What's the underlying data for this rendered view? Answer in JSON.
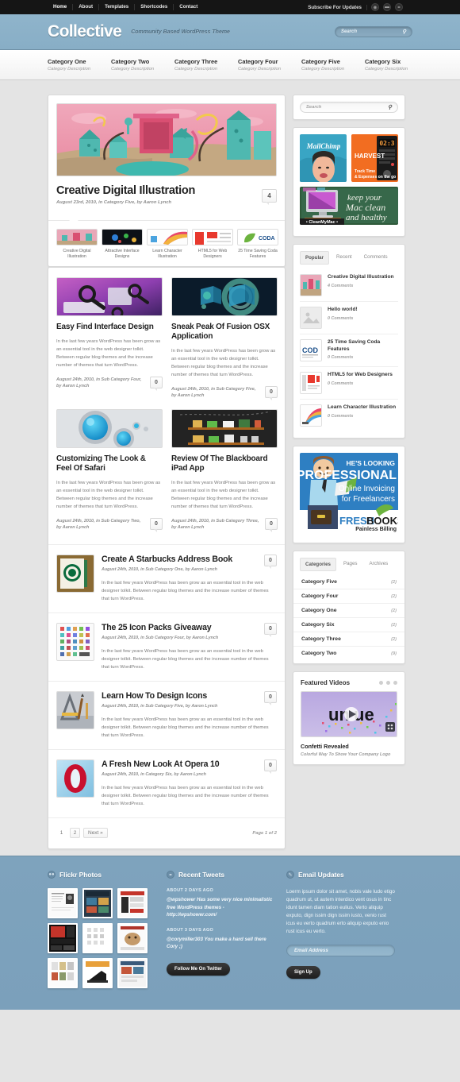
{
  "topbar": {
    "nav": [
      "Home",
      "About",
      "Templates",
      "Shortcodes",
      "Contact"
    ],
    "subscribe_label": "Subscribe For Updates",
    "social": [
      "rss-icon",
      "email-icon",
      "twitter-icon"
    ]
  },
  "header": {
    "logo": "Collective",
    "tagline": "Community Based WordPress Theme",
    "search_placeholder": "Search"
  },
  "catnav": [
    {
      "title": "Category One",
      "desc": "Category Description"
    },
    {
      "title": "Category Two",
      "desc": "Category Description"
    },
    {
      "title": "Category Three",
      "desc": "Category Description"
    },
    {
      "title": "Category Four",
      "desc": "Category Description"
    },
    {
      "title": "Category Five",
      "desc": "Category Description"
    },
    {
      "title": "Category Six",
      "desc": "Category Description"
    }
  ],
  "featured": {
    "title": "Creative Digital Illustration",
    "meta": "August 23rd, 2010, in Category Five, by Aaron Lynch",
    "comments": "4",
    "thumbs": [
      {
        "label": "Creative Digital Illustration"
      },
      {
        "label": "Attractive Interface Designs"
      },
      {
        "label": "Learn Character Illustration"
      },
      {
        "label": "HTML5 for Web Designers"
      },
      {
        "label": "25 Time Saving Coda Features"
      }
    ]
  },
  "grid_posts": [
    {
      "title": "Easy Find Interface Design",
      "excerpt": "In the last few years WordPress has been grow as an essential tool in the web designer tolkit. Between regular blog themes and the increase number of themes that turn WordPress.",
      "meta": "August 24th, 2010, in Sub Category Four, by Aaron Lynch",
      "comments": "0"
    },
    {
      "title": "Sneak Peak Of Fusion OSX Application",
      "excerpt": "In the last few years WordPress has been grow as an essential tool in the web designer tolkit. Between regular blog themes and the increase number of themes that turn WordPress.",
      "meta": "August 24th, 2010, in Sub Category Five, by Aaron Lynch",
      "comments": "0"
    },
    {
      "title": "Customizing The Look & Feel Of Safari",
      "excerpt": "In the last few years WordPress has been grow as an essential tool in the web designer tolkit. Between regular blog themes and the increase number of themes that turn WordPress.",
      "meta": "August 24th, 2010, in Sub Category Two, by Aaron Lynch",
      "comments": "0"
    },
    {
      "title": "Review Of The Blackboard iPad App",
      "excerpt": "In the last few years WordPress has been grow as an essential tool in the web designer tolkit. Between regular blog themes and the increase number of themes that turn WordPress.",
      "meta": "August 24th, 2010, in Sub Category Three, by Aaron Lynch",
      "comments": "0"
    }
  ],
  "list_posts": [
    {
      "title": "Create A Starbucks Address Book",
      "meta": "August 24th, 2010, in Sub Category One, by Aaron Lynch",
      "excerpt": "In the last few years WordPress has been grow as an essential tool in the web designer tolkit. Between regular blog themes and the increase number of themes that turn WordPress.",
      "comments": "0"
    },
    {
      "title": "The 25 Icon Packs Giveaway",
      "meta": "August 24th, 2010, in Sub Category Four, by Aaron Lynch",
      "excerpt": "In the last few years WordPress has been grow as an essential tool in the web designer tolkit. Between regular blog themes and the increase number of themes that turn WordPress.",
      "comments": "0"
    },
    {
      "title": "Learn How To Design Icons",
      "meta": "August 24th, 2010, in Sub Category Five, by Aaron Lynch",
      "excerpt": "In the last few years WordPress has been grow as an essential tool in the web designer tolkit. Between regular blog themes and the increase number of themes that turn WordPress.",
      "comments": "0"
    },
    {
      "title": "A Fresh New Look At Opera 10",
      "meta": "August 24th, 2010, in Category Six, by Aaron Lynch",
      "excerpt": "In the last few years WordPress has been grow as an essential tool in the web designer tolkit. Between regular blog themes and the increase number of themes that turn WordPress.",
      "comments": "0"
    }
  ],
  "pagination": {
    "pages": [
      "1",
      "2"
    ],
    "next_label": "Next »",
    "page_note": "Page 1 of 2"
  },
  "sidebar": {
    "search_placeholder": "Search",
    "ads": [
      {
        "name": "MailChimp",
        "text": "MailChimp"
      },
      {
        "name": "Harvest",
        "text": "HARVEST",
        "sub": "Track Time & Expenses on the go",
        "timer": "02:3"
      },
      {
        "name": "CleanMyMac",
        "text": "keep your Mac clean and healthy",
        "badge": "• CleanMyMac •"
      },
      {
        "name": "FreshBooks",
        "line1": "HE'S LOOKING",
        "line2": "PROFESSIONAL",
        "line3": "Online Invoicing",
        "line4": "for Freelancers",
        "brand1": "FRESH",
        "brand2": "BOOKS",
        "brand3": "Painless Billing"
      }
    ],
    "popular_tabs": [
      "Popular",
      "Recent",
      "Comments"
    ],
    "popular_active": "Popular",
    "popular_items": [
      {
        "title": "Creative Digital Illustration",
        "comments": "4 Comments"
      },
      {
        "title": "Hello world!",
        "comments": "0 Comments"
      },
      {
        "title": "25 Time Saving Coda Features",
        "comments": "0 Comments"
      },
      {
        "title": "HTML5 for Web Designers",
        "comments": "0 Comments"
      },
      {
        "title": "Learn Character Illustration",
        "comments": "0 Comments"
      }
    ],
    "cat_tabs": [
      "Categories",
      "Pages",
      "Archives"
    ],
    "cat_active": "Categories",
    "categories": [
      {
        "name": "Category Five",
        "count": "(2)"
      },
      {
        "name": "Category Four",
        "count": "(2)"
      },
      {
        "name": "Category One",
        "count": "(2)"
      },
      {
        "name": "Category Six",
        "count": "(2)"
      },
      {
        "name": "Category Three",
        "count": "(2)"
      },
      {
        "name": "Category Two",
        "count": "(9)"
      }
    ],
    "videos": {
      "heading": "Featured Videos",
      "video_title": "Confetti Revealed",
      "video_sub": "Colorful Way To Show Your Company Logo",
      "overlay_text": "unique"
    }
  },
  "footer": {
    "flickr": {
      "heading": "Flickr Photos",
      "icon": "flickr-icon"
    },
    "tweets": {
      "heading": "Recent Tweets",
      "icon": "twitter-icon",
      "items": [
        {
          "when": "ABOUT 2 DAYS AGO",
          "text": "@wpshower Has some very nice minimalistic free WordPress themes - http://wpshower.com/"
        },
        {
          "when": "ABOUT 3 DAYS AGO",
          "text": "@corymiller303 You make a hard sell there Cory ;)"
        }
      ],
      "button": "Follow Me On Twitter"
    },
    "email": {
      "heading": "Email Updates",
      "icon": "mail-icon",
      "text": "Loerm ipsum dolor sit amet, nobis vale ludo etigo quadrum ut, ut autem interdico vent osus in tinc idunt tamen diam tation eulius. Verto aliquip exputo, dign issim dign issim iusto, venio rust icus eu verto quadrum erto aliquip exputo enio rust icus eu verto.",
      "input_placeholder": "Email Address",
      "button": "Sign Up"
    }
  },
  "colors": {
    "topbar": "#151515",
    "header_band": "#8fb4cb",
    "footer_band": "#7ea3bd",
    "page_bg": "#e4e4e4",
    "panel": "#ffffff"
  }
}
